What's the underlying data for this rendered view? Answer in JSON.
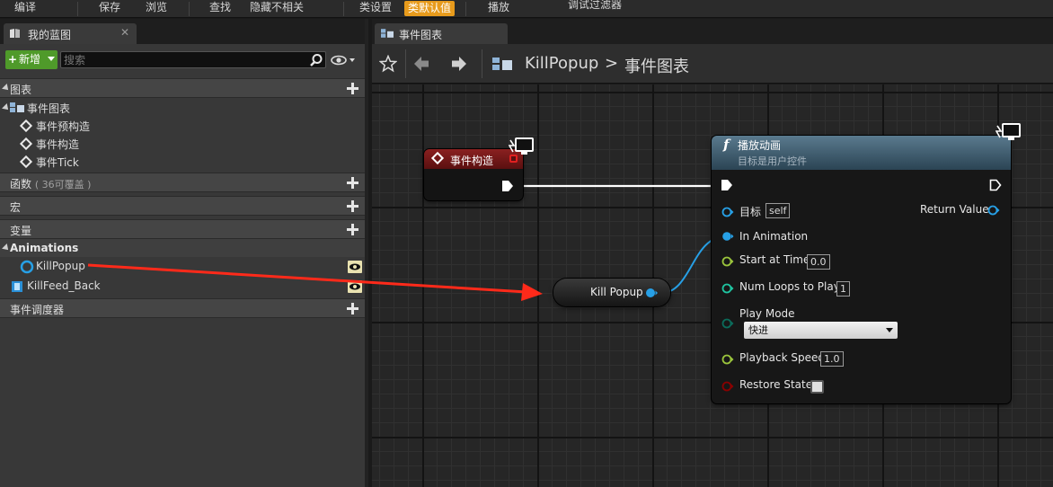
{
  "toolbar": {
    "compile": "编译",
    "save": "保存",
    "browse": "浏览",
    "find": "查找",
    "hide_unrelated": "隐藏不相关",
    "class_settings": "类设置",
    "class_defaults": "类默认值",
    "play": "播放",
    "debug_filter": "调试过滤器"
  },
  "left_panel": {
    "tab_title": "我的蓝图",
    "tab_close": "✕",
    "add_button": "新增",
    "search_placeholder": "搜索",
    "sections": {
      "graphs": "图表",
      "functions": "函数",
      "functions_hint": "( 36可覆盖 )",
      "macros": "宏",
      "variables": "变量",
      "event_dispatchers": "事件调度器"
    },
    "graph_items": {
      "event_graph": "事件图表",
      "pre_construct": "事件预构造",
      "construct": "事件构造",
      "tick": "事件Tick"
    },
    "animations_header": "Animations",
    "variables_list": [
      "KillPopup",
      "KillFeed_Back"
    ]
  },
  "graph_tab": {
    "title": "事件图表"
  },
  "breadcrumb": {
    "blueprint": "KillPopup",
    "separator": ">",
    "graph": "事件图表"
  },
  "event_node": {
    "title": "事件构造"
  },
  "play_anim_node": {
    "title": "播放动画",
    "subtitle": "目标是用户控件",
    "target_label": "目标",
    "target_value": "self",
    "return_value": "Return Value",
    "in_animation": "In Animation",
    "start_at_time": "Start at Time",
    "start_at_time_value": "0.0",
    "num_loops": "Num Loops to Play",
    "num_loops_value": "1",
    "play_mode": "Play Mode",
    "play_mode_value": "快进",
    "playback_speed": "Playback Speed",
    "playback_speed_value": "1.0",
    "restore_state": "Restore State"
  },
  "var_node": {
    "label": "Kill Popup"
  },
  "colors": {
    "accent_orange": "#e89b1c",
    "add_green": "#4f9a2a",
    "event_red": "#8a2020",
    "function_blue": "#5a7a8e",
    "object_pin": "#27a0e6",
    "float_pin": "#9ac43c",
    "int_pin": "#1fc4a0",
    "enum_pin": "#0b6b5a",
    "bool_pin": "#8a0000",
    "arrow_red": "#ff2a1a"
  }
}
